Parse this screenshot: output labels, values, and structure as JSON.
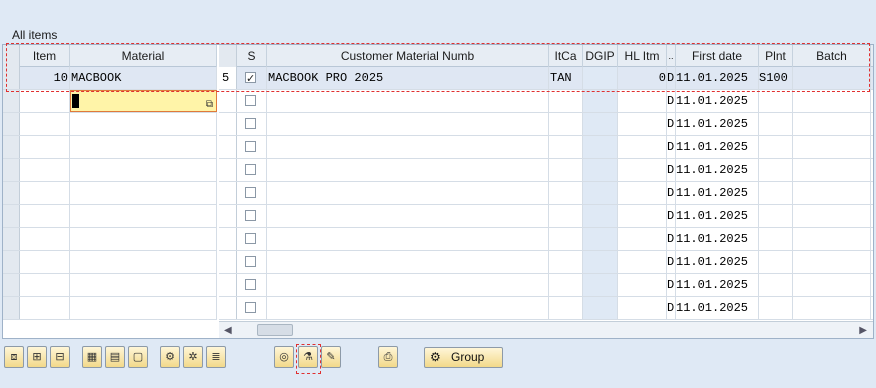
{
  "section_title": "All items",
  "left_headers": [
    "Item",
    "Material"
  ],
  "right_headers": [
    "S",
    "Customer Material Numb",
    "ItCa",
    "DGIP",
    "HL Itm",
    "..",
    "First date",
    "Plnt",
    "Batch"
  ],
  "row1": {
    "item": "10",
    "material": "MACBOOK",
    "s_value": "5",
    "customer_material": "MACBOOK PRO 2025",
    "itca": "TAN",
    "dgip": "",
    "hl_itm": "0",
    "dot": "D",
    "first_date": "11.01.2025",
    "plnt": "S100",
    "batch": ""
  },
  "empty_rows": [
    {
      "dot": "D",
      "first_date": "11.01.2025"
    },
    {
      "dot": "D",
      "first_date": "11.01.2025"
    },
    {
      "dot": "D",
      "first_date": "11.01.2025"
    },
    {
      "dot": "D",
      "first_date": "11.01.2025"
    },
    {
      "dot": "D",
      "first_date": "11.01.2025"
    },
    {
      "dot": "D",
      "first_date": "11.01.2025"
    },
    {
      "dot": "D",
      "first_date": "11.01.2025"
    },
    {
      "dot": "D",
      "first_date": "11.01.2025"
    },
    {
      "dot": "D",
      "first_date": "11.01.2025"
    },
    {
      "dot": "D",
      "first_date": "11.01.2025"
    }
  ],
  "toolbar": {
    "group_label": "Group",
    "icons": [
      "item-details-icon",
      "insert-row-icon",
      "delete-row-icon",
      "select-all-icon",
      "select-block-icon",
      "deselect-icon",
      "config-icon",
      "pricing-icon",
      "list-icon",
      "target-icon",
      "sort-icon",
      "edit-icon",
      "print-icon",
      "group-icon"
    ]
  },
  "colors": {
    "background": "#dfe9f5",
    "highlight_red": "#e03030",
    "input_yellow": "#fff4a8",
    "button_gold": "#f2d98a"
  }
}
